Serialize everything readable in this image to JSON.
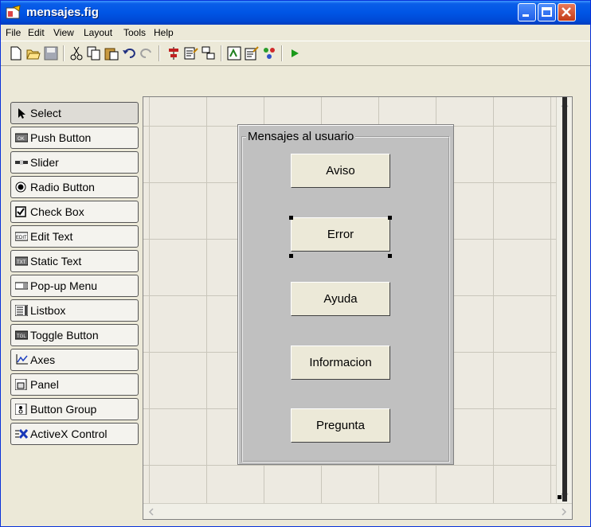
{
  "window": {
    "title": "mensajes.fig",
    "title_color": "#0055e5"
  },
  "menu": [
    "File",
    "Edit",
    "View",
    "Layout",
    "Tools",
    "Help"
  ],
  "toolbar": [
    "new-file-icon",
    "open-folder-icon",
    "save-icon",
    "cut-icon",
    "copy-icon",
    "paste-icon",
    "undo-icon",
    "redo-icon",
    "align-objects-icon",
    "menu-editor-icon",
    "tab-order-editor-icon",
    "m-file-editor-icon",
    "property-inspector-icon",
    "object-browser-icon",
    "run-icon"
  ],
  "palette": [
    {
      "label": "Select",
      "icon": "arrow-cursor-icon",
      "selected": true
    },
    {
      "label": "Push Button",
      "icon": "push-button-icon"
    },
    {
      "label": "Slider",
      "icon": "slider-icon"
    },
    {
      "label": "Radio Button",
      "icon": "radio-button-icon"
    },
    {
      "label": "Check Box",
      "icon": "check-box-icon"
    },
    {
      "label": "Edit Text",
      "icon": "edit-text-icon"
    },
    {
      "label": "Static Text",
      "icon": "static-text-icon"
    },
    {
      "label": "Pop-up Menu",
      "icon": "popup-menu-icon"
    },
    {
      "label": "Listbox",
      "icon": "listbox-icon"
    },
    {
      "label": "Toggle Button",
      "icon": "toggle-button-icon"
    },
    {
      "label": "Axes",
      "icon": "axes-icon"
    },
    {
      "label": "Panel",
      "icon": "panel-icon"
    },
    {
      "label": "Button Group",
      "icon": "button-group-icon"
    },
    {
      "label": "ActiveX Control",
      "icon": "activex-icon"
    }
  ],
  "panel": {
    "title": "Mensajes al usuario",
    "buttons": [
      {
        "label": "Aviso"
      },
      {
        "label": "Error",
        "selected": true
      },
      {
        "label": "Ayuda"
      },
      {
        "label": "Informacion"
      },
      {
        "label": "Pregunta"
      }
    ]
  }
}
